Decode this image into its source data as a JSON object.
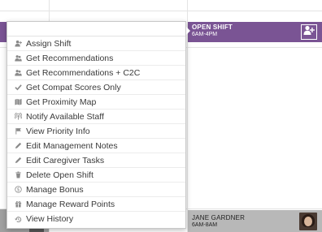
{
  "open_shift": {
    "title": "OPEN SHIFT",
    "time": "6AM-4PM",
    "accent_color": "#7a5494",
    "action_icon": "add-person-icon"
  },
  "filled_shift": {
    "caregiver_name": "JANE GARDNER",
    "time": "6AM-8AM"
  },
  "context_menu": {
    "items": [
      {
        "label": "Assign Shift",
        "icon": "assign-person-icon"
      },
      {
        "label": "Get Recommendations",
        "icon": "recommend-users-icon"
      },
      {
        "label": "Get Recommendations + C2C",
        "icon": "recommend-users-icon"
      },
      {
        "label": "Get Compat Scores Only",
        "icon": "check-icon"
      },
      {
        "label": "Get Proximity Map",
        "icon": "map-icon"
      },
      {
        "label": "Notify Available Staff",
        "icon": "broadcast-icon"
      },
      {
        "label": "View Priority Info",
        "icon": "flag-icon"
      },
      {
        "label": "Edit Management Notes",
        "icon": "pencil-icon"
      },
      {
        "label": "Edit Caregiver Tasks",
        "icon": "pencil-icon"
      },
      {
        "label": "Delete Open Shift",
        "icon": "trash-icon"
      },
      {
        "label": "Manage Bonus",
        "icon": "dollar-icon"
      },
      {
        "label": "Manage Reward Points",
        "icon": "gift-icon"
      },
      {
        "label": "View History",
        "icon": "history-icon"
      }
    ]
  }
}
